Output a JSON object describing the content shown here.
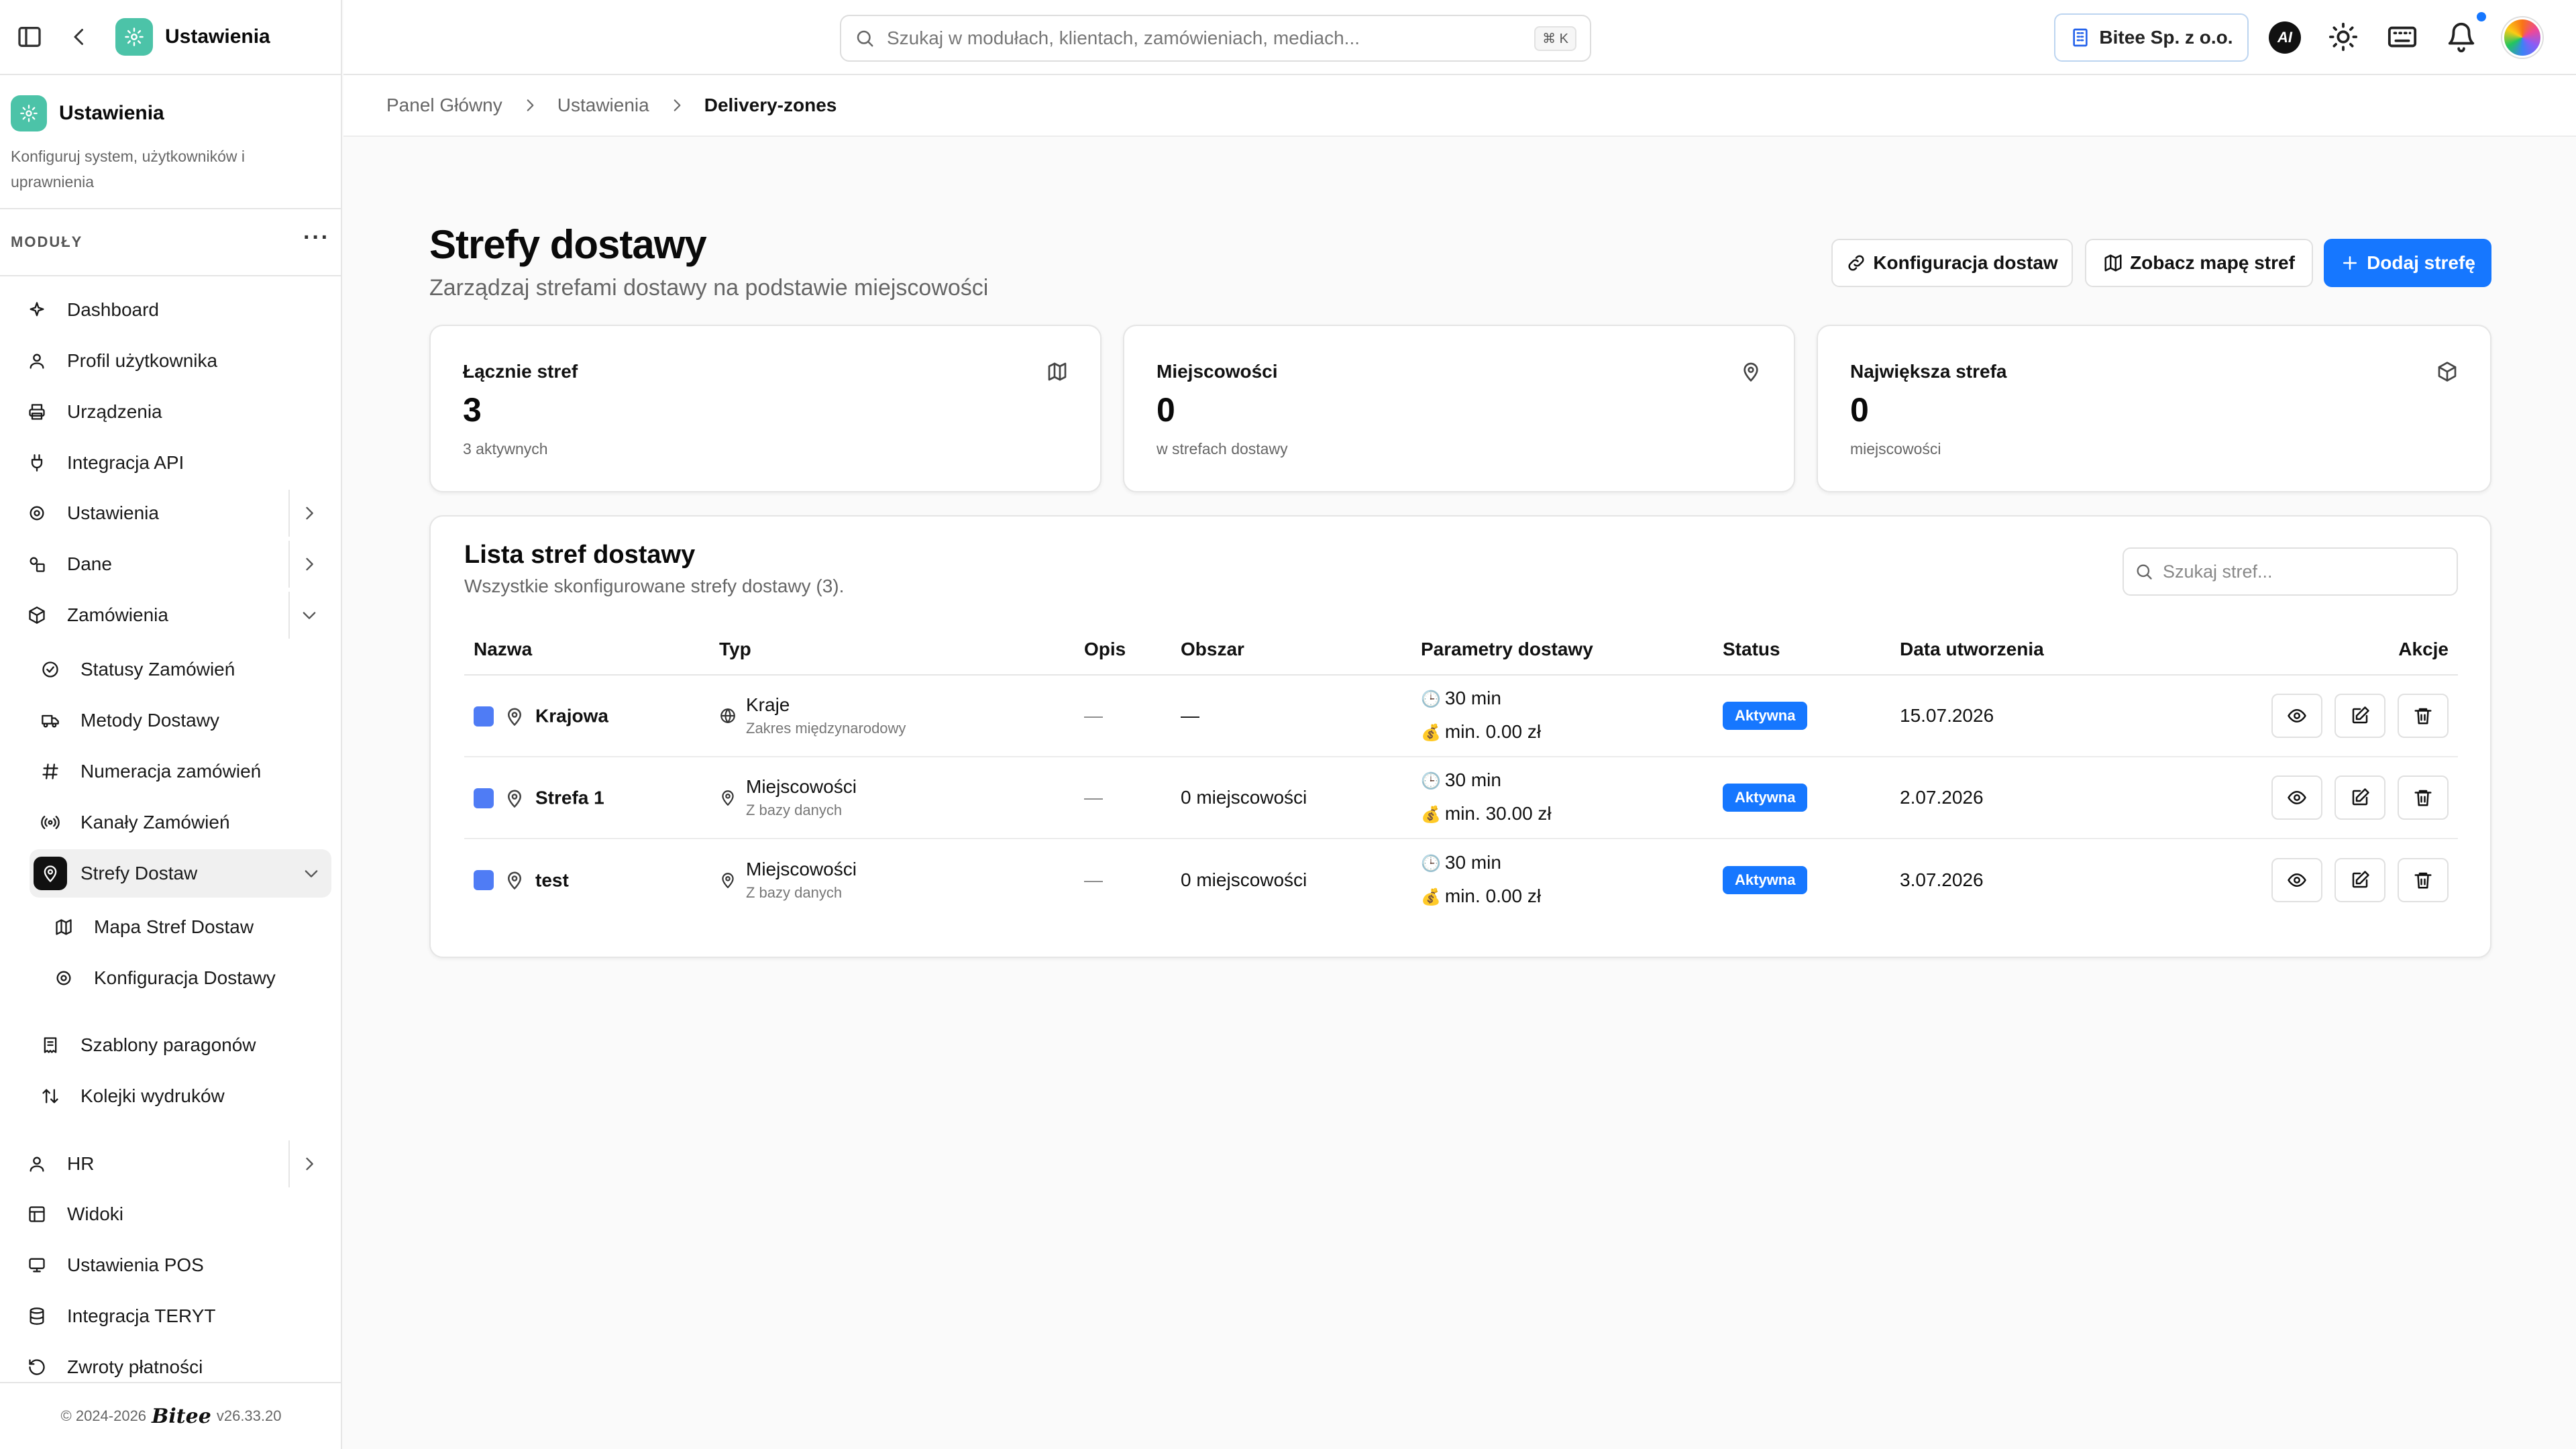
{
  "sidebar": {
    "app_title": "Ustawienia",
    "section_title": "Ustawienia",
    "section_desc": "Konfiguruj system, użytkowników i uprawnienia",
    "modules_label": "MODUŁY",
    "items": [
      {
        "label": "Dashboard"
      },
      {
        "label": "Profil użytkownika"
      },
      {
        "label": "Urządzenia"
      },
      {
        "label": "Integracja API"
      },
      {
        "label": "Ustawienia"
      },
      {
        "label": "Dane"
      },
      {
        "label": "Zamówienia"
      },
      {
        "label": "Statusy Zamówień"
      },
      {
        "label": "Metody Dostawy"
      },
      {
        "label": "Numeracja zamówień"
      },
      {
        "label": "Kanały Zamówień"
      },
      {
        "label": "Strefy Dostaw"
      },
      {
        "label": "Mapa Stref Dostaw"
      },
      {
        "label": "Konfiguracja Dostawy"
      },
      {
        "label": "Szablony paragonów"
      },
      {
        "label": "Kolejki wydruków"
      },
      {
        "label": "HR"
      },
      {
        "label": "Widoki"
      },
      {
        "label": "Ustawienia POS"
      },
      {
        "label": "Integracja TERYT"
      },
      {
        "label": "Zwroty płatności"
      }
    ],
    "footer_copy": "© 2024-2026",
    "footer_brand": "Bitee",
    "footer_version": "v26.33.20"
  },
  "header": {
    "search_placeholder": "Szukaj w modułach, klientach, zamówieniach, mediach...",
    "search_shortcut": "⌘ K",
    "company": "Bitee Sp. z o.o.",
    "ai_label": "AI"
  },
  "breadcrumb": [
    "Panel Główny",
    "Ustawienia",
    "Delivery-zones"
  ],
  "page": {
    "title": "Strefy dostawy",
    "subtitle": "Zarządzaj strefami dostawy na podstawie miejscowości",
    "btn_config": "Konfiguracja dostaw",
    "btn_map": "Zobacz mapę stref",
    "btn_add": "Dodaj strefę"
  },
  "stats": [
    {
      "label": "Łącznie stref",
      "value": "3",
      "note": "3 aktywnych"
    },
    {
      "label": "Miejscowości",
      "value": "0",
      "note": "w strefach dostawy"
    },
    {
      "label": "Największa strefa",
      "value": "0",
      "note": "miejscowości"
    }
  ],
  "list": {
    "title": "Lista stref dostawy",
    "subtitle": "Wszystkie skonfigurowane strefy dostawy (3).",
    "search_placeholder": "Szukaj stref...",
    "columns": [
      "Nazwa",
      "Typ",
      "Opis",
      "Obszar",
      "Parametry dostawy",
      "Status",
      "Data utworzenia",
      "Akcje"
    ],
    "rows": [
      {
        "name": "Krajowa",
        "type": "Kraje",
        "type_sub": "Zakres międzynarodowy",
        "type_icon": "globe-icon",
        "desc": "—",
        "area": "—",
        "time": "30 min",
        "min": "min. 0.00 zł",
        "status": "Aktywna",
        "date": "15.07.2026"
      },
      {
        "name": "Strefa 1",
        "type": "Miejscowości",
        "type_sub": "Z bazy danych",
        "type_icon": "map-pin-icon",
        "desc": "—",
        "area": "0 miejscowości",
        "time": "30 min",
        "min": "min. 30.00 zł",
        "status": "Aktywna",
        "date": "2.07.2026"
      },
      {
        "name": "test",
        "type": "Miejscowości",
        "type_sub": "Z bazy danych",
        "type_icon": "map-pin-icon",
        "desc": "—",
        "area": "0 miejscowości",
        "time": "30 min",
        "min": "min. 0.00 zł",
        "status": "Aktywna",
        "date": "3.07.2026"
      }
    ]
  },
  "colors": {
    "accent": "#1677ff",
    "brand_teal": "#4cc3a8",
    "zone_swatch": "#4f7cf5"
  }
}
